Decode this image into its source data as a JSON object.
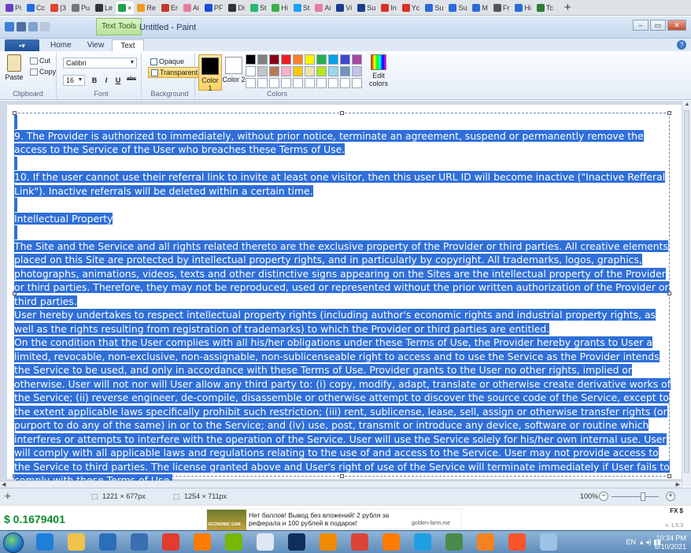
{
  "browser": {
    "tabs": [
      {
        "label": "Pi",
        "color": "#6a3fc1"
      },
      {
        "label": "Cc",
        "color": "#1f6fe0"
      },
      {
        "label": "(3",
        "color": "#e0432f"
      },
      {
        "label": "Pu",
        "color": "#777777"
      },
      {
        "label": "Le",
        "color": "#333333"
      },
      {
        "label": "×",
        "color": "#22a04a"
      },
      {
        "label": "Re",
        "color": "#f29a1e"
      },
      {
        "label": "Er",
        "color": "#c0392b"
      },
      {
        "label": "Ai",
        "color": "#e67e9c"
      },
      {
        "label": "PF",
        "color": "#1d4ed8"
      },
      {
        "label": "Di",
        "color": "#333333"
      },
      {
        "label": "St",
        "color": "#2bb673"
      },
      {
        "label": "Hi",
        "color": "#3fae49"
      },
      {
        "label": "St",
        "color": "#1da1f2"
      },
      {
        "label": "Ai",
        "color": "#e67e9c"
      },
      {
        "label": "Vi",
        "color": "#1a3d8f"
      },
      {
        "label": "Su",
        "color": "#1a3d8f"
      },
      {
        "label": "In",
        "color": "#d93025"
      },
      {
        "label": "Yc",
        "color": "#d93025"
      },
      {
        "label": "Su",
        "color": "#2a6cd6"
      },
      {
        "label": "Su",
        "color": "#2a6cd6"
      },
      {
        "label": "M",
        "color": "#2a6cd6"
      },
      {
        "label": "Fr",
        "color": "#555555"
      },
      {
        "label": "Hi",
        "color": "#2a6cd6"
      },
      {
        "label": "Tc",
        "color": "#2e7d32"
      }
    ],
    "new_tab": "+"
  },
  "window": {
    "context_tab": "Text Tools",
    "title": "Untitled - Paint",
    "controls": {
      "minimize": "–",
      "maximize": "▭",
      "close": "✕"
    }
  },
  "ribbon_tabs": {
    "file": "▪▾",
    "home": "Home",
    "view": "View",
    "text": "Text",
    "help": "?"
  },
  "ribbon": {
    "clipboard": {
      "paste": "Paste",
      "cut": "Cut",
      "copy": "Copy",
      "label": "Clipboard"
    },
    "font": {
      "family": "Calibri",
      "size": "16",
      "bold": "B",
      "italic": "I",
      "underline": "U",
      "strike": "abc",
      "label": "Font"
    },
    "background": {
      "opaque": "Opaque",
      "transparent": "Transparent",
      "label": "Background"
    },
    "colors": {
      "color1": "Color 1",
      "color2": "Color 2",
      "label": "Colors",
      "edit": "Edit colors",
      "color1_value": "#000000",
      "color2_value": "#ffffff",
      "palette": [
        "#000000",
        "#7f7f7f",
        "#880015",
        "#ed1c24",
        "#ff7f27",
        "#fff200",
        "#22b14c",
        "#00a2e8",
        "#3f48cc",
        "#a349a4",
        "#ffffff",
        "#c3c3c3",
        "#b97a57",
        "#ffaec9",
        "#ffc90e",
        "#efe4b0",
        "#b5e61d",
        "#99d9ea",
        "#7092be",
        "#c8bfe7",
        "#ffffff",
        "#ffffff",
        "#ffffff",
        "#ffffff",
        "#ffffff",
        "#ffffff",
        "#ffffff",
        "#ffffff",
        "#ffffff",
        "#ffffff"
      ]
    }
  },
  "document": {
    "paragraphs": [
      "",
      "9. The Provider is authorized to immediately, without prior notice, terminate an agreement, suspend or permanently remove the access to the Service of the User who breaches these Terms of Use.",
      "",
      "10. If the user cannot use their referral link to invite at least one visitor, then this user URL ID will become inactive (\"Inactive Refferal Link\"). Inactive referrals will be deleted within a certain time.",
      "",
      "Intellectual Property",
      "",
      "The Site and the Service and all rights related thereto are the exclusive property of the Provider or third parties. All creative elements placed on this Site are protected by intellectual property rights, and in particularly by copyright. All trademarks, logos, graphics, photographs, animations, videos, texts and other distinctive signs appearing on the Sites are the intellectual property of the Provider or third parties. Therefore, they may not be reproduced, used or represented without the prior written authorization of the Provider or third parties.",
      "User hereby undertakes to respect intellectual property rights (including author's economic rights and industrial property rights, as well as the rights resulting from registration of trademarks) to which the Provider or third parties are entitled.",
      "On the condition that the User complies with all his/her obligations under these Terms of Use, the Provider hereby grants to User a limited, revocable, non-exclusive, non-assignable, non-sublicenseable right to access and to use the Service as the Provider intends the Service to be used, and only in accordance with these Terms of Use. Provider grants to the User no other rights, implied or otherwise. User will not nor will User allow any third party to: (i) copy, modify, adapt, translate or otherwise create derivative works of the Service; (ii) reverse engineer, de-compile, disassemble or otherwise attempt to discover the source code of the Service, except to the extent applicable laws specifically prohibit such restriction; (iii) rent, sublicense, lease, sell, assign or otherwise transfer rights (or purport to do any of the same) in or to the Service; and (iv) use, post, transmit or introduce any device, software or routine which interferes or attempts to interfere with the operation of the Service. User will use the Service solely for his/her own internal use. User will comply with all applicable laws and regulations relating to the use of and access to the Service. User may not provide access to the Service to third parties. The license granted above and User's right of use of the Service will terminate immediately if User fails to comply with these Terms of Use."
    ]
  },
  "status": {
    "selection": "1221 × 677px",
    "canvas_size": "1254 × 711px",
    "zoom": "100%"
  },
  "extension_bar": {
    "price": "$ 0.1679401",
    "ad_text": "Нет баллов! Вывод без вложений! 2 рубля за реферала и 100 рублей в подарок!",
    "ad_source": "golden-farm.me",
    "ad_thumb_text": "ECONOMIC GAM",
    "fx": "FX  $",
    "version": "v. 1.5.3"
  },
  "taskbar": {
    "lang": "EN",
    "time": "10:34 PM",
    "date": "6/10/2021",
    "icons": [
      {
        "name": "ie-icon",
        "color": "#1e7fd6"
      },
      {
        "name": "explorer-icon",
        "color": "#f1c24a"
      },
      {
        "name": "media-icon",
        "color": "#2b6fb8"
      },
      {
        "name": "chrome-old-icon",
        "color": "#3a6fb0"
      },
      {
        "name": "balloon-icon",
        "color": "#e33b2d"
      },
      {
        "name": "illustrator-icon",
        "color": "#ff7c00"
      },
      {
        "name": "nvidia-icon",
        "color": "#76b900"
      },
      {
        "name": "word-icon",
        "color": "#dfe7f1"
      },
      {
        "name": "photoshop-icon",
        "color": "#0f2f5c"
      },
      {
        "name": "vlc-icon",
        "color": "#f08a00"
      },
      {
        "name": "chrome-icon",
        "color": "#db4437"
      },
      {
        "name": "illustrator2-icon",
        "color": "#ff7c00"
      },
      {
        "name": "edge-icon",
        "color": "#1fa0e3"
      },
      {
        "name": "screen-icon",
        "color": "#4a8a4a"
      },
      {
        "name": "ccleaner-icon",
        "color": "#f58220"
      },
      {
        "name": "brave-icon",
        "color": "#fb542b"
      },
      {
        "name": "paint-icon",
        "color": "#9cc3e6"
      }
    ]
  }
}
